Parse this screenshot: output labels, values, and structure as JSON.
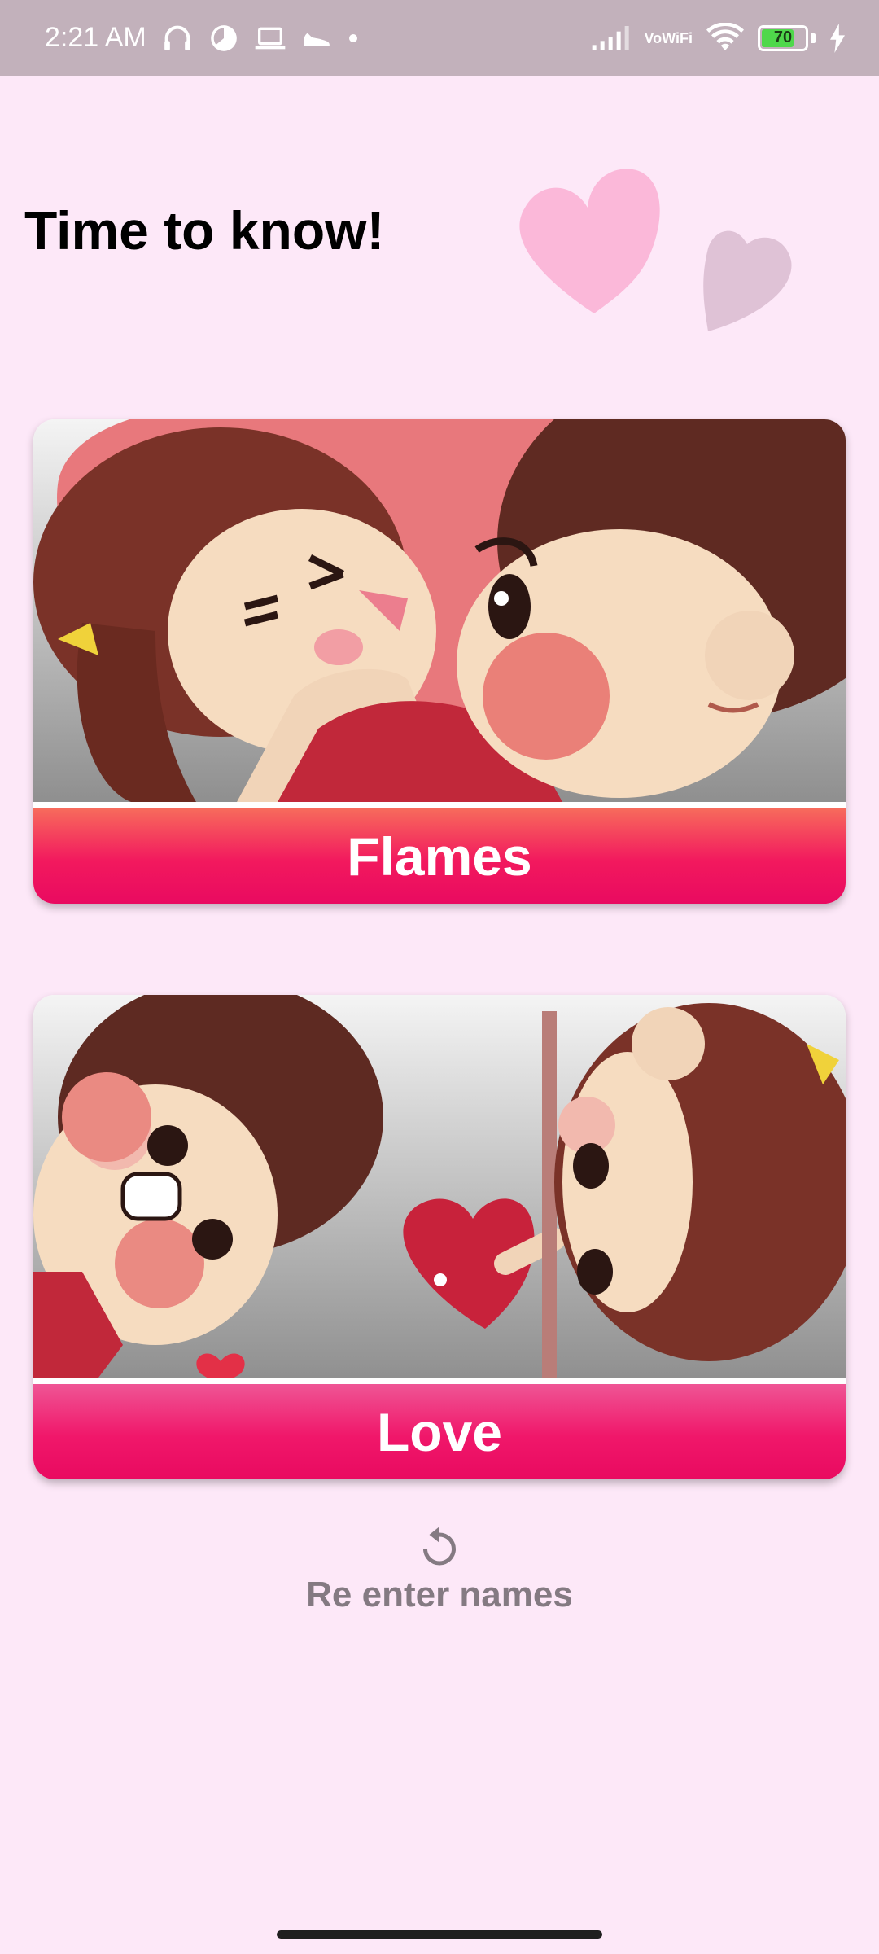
{
  "status_bar": {
    "time": "2:21 AM",
    "vowifi_top": "Vo",
    "vowifi_bottom": "WiFi",
    "battery_level": "70"
  },
  "header": {
    "title": "Time to know!"
  },
  "cards": {
    "flames": {
      "label": "Flames"
    },
    "love": {
      "label": "Love"
    }
  },
  "reenter": {
    "label": "Re enter names"
  },
  "colors": {
    "background": "#fde8f8",
    "status_bar": "#c2b1bb",
    "flames_gradient": [
      "#f76b5c",
      "#e90a60"
    ],
    "love_gradient": [
      "#ef5595",
      "#e90a60"
    ],
    "reenter_text": "#847a82"
  }
}
